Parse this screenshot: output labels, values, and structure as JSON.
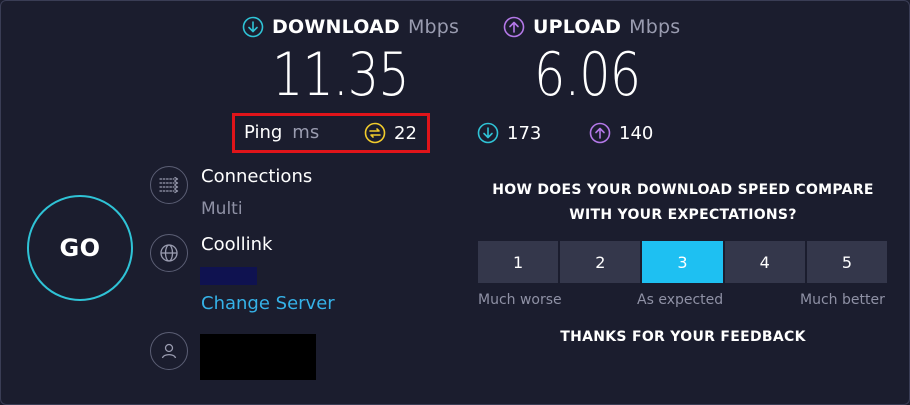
{
  "download": {
    "label": "DOWNLOAD",
    "unit": "Mbps",
    "value": "11.35",
    "color": "#2fc3d6"
  },
  "upload": {
    "label": "UPLOAD",
    "unit": "Mbps",
    "value": "6.06",
    "color": "#b478e8"
  },
  "ping": {
    "label": "Ping",
    "unit": "ms",
    "value": "22",
    "color": "#f2cc2c"
  },
  "latency": {
    "download_value": "173",
    "upload_value": "140"
  },
  "go_button": {
    "label": "GO"
  },
  "connections": {
    "title": "Connections",
    "value": "Multi"
  },
  "server": {
    "name": "Coollink",
    "change_label": "Change Server"
  },
  "feedback": {
    "question_line1": "HOW DOES YOUR DOWNLOAD SPEED COMPARE",
    "question_line2": "WITH YOUR EXPECTATIONS?",
    "options": [
      "1",
      "2",
      "3",
      "4",
      "5"
    ],
    "selected": "3",
    "low_label": "Much worse",
    "mid_label": "As expected",
    "high_label": "Much better",
    "thanks": "THANKS FOR YOUR FEEDBACK"
  },
  "icons": {
    "download": "download-arrow-icon",
    "upload": "upload-arrow-icon",
    "ping": "ping-icon",
    "connections": "connections-icon",
    "server": "globe-icon",
    "user": "user-icon"
  }
}
